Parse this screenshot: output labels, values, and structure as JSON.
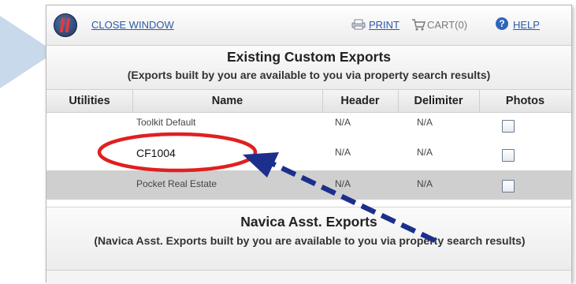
{
  "toolbar": {
    "close_label": "CLOSE WINDOW",
    "print_label": "PRINT",
    "cart_label": "CART(0)",
    "help_label": "HELP"
  },
  "section1": {
    "title": "Existing Custom Exports",
    "subtitle": "(Exports built by you are available to you via property search results)"
  },
  "table": {
    "headers": [
      "Utilities",
      "Name",
      "Header",
      "Delimiter",
      "Photos"
    ],
    "rows": [
      {
        "name": "Toolkit Default",
        "header": "N/A",
        "delimiter": "N/A",
        "photos_checked": false
      },
      {
        "name": "CF1004",
        "header": "N/A",
        "delimiter": "N/A",
        "photos_checked": false
      },
      {
        "name": "Pocket Real Estate",
        "header": "N/A",
        "delimiter": "N/A",
        "photos_checked": false
      }
    ]
  },
  "section2": {
    "title": "Navica Asst. Exports",
    "subtitle": "(Navica Asst. Exports built by you are available to you via property search results)"
  },
  "annotation": {
    "circle_color": "#e02020",
    "arrow_color": "#1c2f8c"
  },
  "colors": {
    "link": "#2b5aa8",
    "row_highlight": "#cfcfcf",
    "pointer_shape": "#c9d9ec"
  }
}
